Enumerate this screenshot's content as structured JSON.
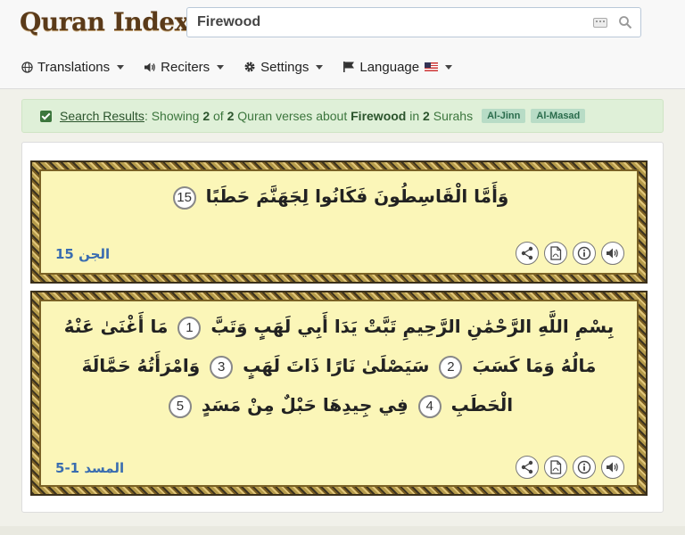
{
  "header": {
    "logo_text": "Quran Index",
    "search": {
      "value": "Firewood",
      "placeholder": ""
    },
    "nav": [
      {
        "label": "Translations",
        "icon": "globe-icon"
      },
      {
        "label": "Reciters",
        "icon": "speaker-icon"
      },
      {
        "label": "Settings",
        "icon": "gear-icon"
      },
      {
        "label": "Language",
        "icon": "flag-icon"
      }
    ]
  },
  "results": {
    "link": "Search Results",
    "t1": ": Showing ",
    "shown": "2",
    "t2": " of ",
    "total": "2",
    "t3": " Quran verses about ",
    "query": "Firewood",
    "t4": " in ",
    "surah_count": "2",
    "t5": " Surahs",
    "tags": [
      "Al-Jinn",
      "Al-Masad"
    ]
  },
  "verses": [
    {
      "segments": [
        {
          "text": "وَأَمَّا الْقَاسِطُونَ فَكَانُوا لِجَهَنَّمَ حَطَبًا",
          "num": "15"
        }
      ],
      "reference": "الجن 15"
    },
    {
      "segments": [
        {
          "text": "بِسْمِ اللَّهِ الرَّحْمَٰنِ الرَّحِيمِ تَبَّتْ يَدَا أَبِي لَهَبٍ وَتَبَّ",
          "num": "1"
        },
        {
          "text": "مَا أَغْنَىٰ عَنْهُ مَالُهُ وَمَا كَسَبَ",
          "num": "2"
        },
        {
          "text": "سَيَصْلَىٰ نَارًا ذَاتَ لَهَبٍ",
          "num": "3"
        },
        {
          "text": "وَامْرَأَتُهُ حَمَّالَةَ الْحَطَبِ",
          "num": "4"
        },
        {
          "text": "فِي جِيدِهَا حَبْلٌ مِنْ مَسَدٍ",
          "num": "5"
        }
      ],
      "reference": "المسد 1-5"
    }
  ],
  "actions": [
    "share-icon",
    "pdf-icon",
    "info-icon",
    "audio-icon"
  ],
  "colors": {
    "accent": "#3a6db0",
    "success_bg": "#dff0d8",
    "verse_bg": "#fbf6b8",
    "logo": "#5a3a1a"
  }
}
